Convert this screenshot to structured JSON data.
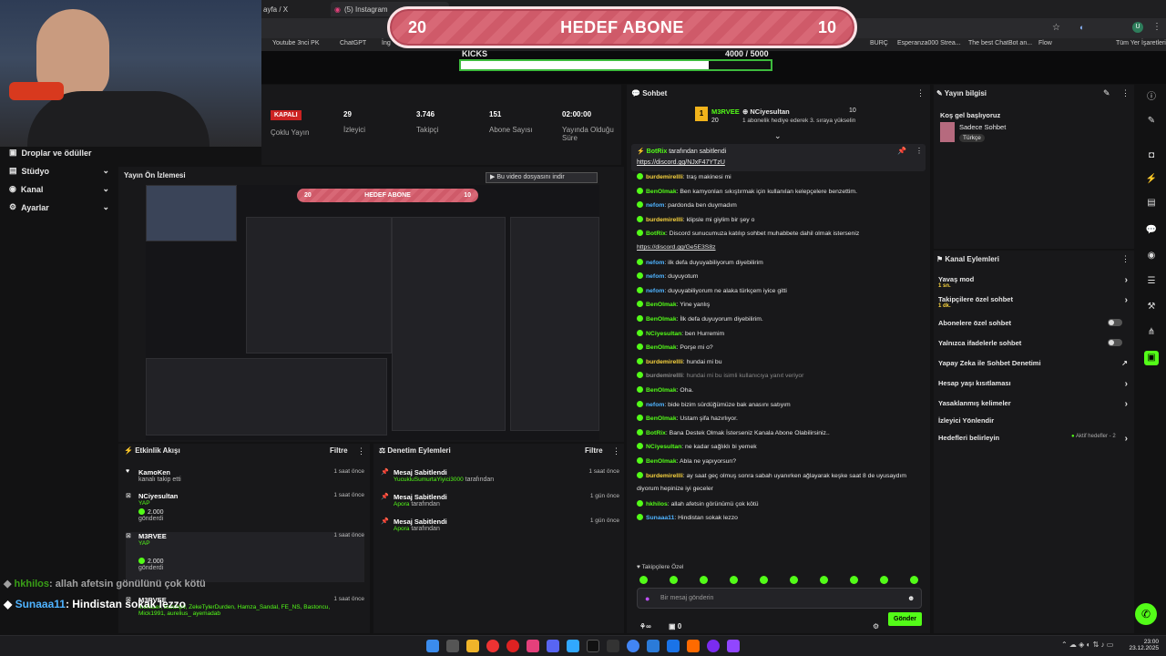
{
  "browser": {
    "tabs": [
      "ayfa / X",
      "(5) Instagram"
    ],
    "bookmarks": [
      "Youtube 3nci PK",
      "ChatGPT",
      "İng",
      "BURÇ",
      "Esperanza000 Strea...",
      "The best ChatBot an...",
      "Flow",
      "Tüm Yer İşaretleri"
    ]
  },
  "goal": {
    "left": "20",
    "title": "HEDEF ABONE",
    "right": "10"
  },
  "kicks": {
    "label": "KICKS",
    "current": "4000",
    "sep": "/",
    "target": "5000",
    "progress": 0.8
  },
  "leftnav": [
    {
      "label": "Droplar ve ödüller",
      "icon": "gift-icon"
    },
    {
      "label": "Stüdyo",
      "icon": "studio-icon"
    },
    {
      "label": "Kanal",
      "icon": "channel-icon"
    },
    {
      "label": "Ayarlar",
      "icon": "gear-icon"
    }
  ],
  "stats": {
    "status": "KAPALI",
    "mode": "Çoklu Yayın",
    "viewers_v": "29",
    "viewers_l": "İzleyici",
    "followers_v": "3.746",
    "followers_l": "Takipçi",
    "subs_v": "151",
    "subs_l": "Abone Sayısı",
    "uptime_v": "02:00:00",
    "uptime_l": "Yayında Olduğu Süre"
  },
  "preview": {
    "title": "Yayın Ön İzlemesi",
    "download": "Bu video dosyasını indir",
    "mini_left": "20",
    "mini_title": "HEDEF ABONE",
    "mini_right": "10"
  },
  "activity": {
    "title": "Etkinlik Akışı",
    "filter": "Filtre",
    "items": [
      {
        "name": "KamoKen",
        "sub": "kanalı takip etti",
        "time": "1 saat önce"
      },
      {
        "name": "NCiyesultan",
        "sub": "YAP",
        "amount": "2.000",
        "action": "gönderdi",
        "time": "1 saat önce"
      },
      {
        "name": "M3RVEE",
        "sub": "YAP",
        "amount": "2.000",
        "action": "gönderdi",
        "time": "1 saat önce"
      },
      {
        "name": "M3RVEE",
        "sub": "melisaer, Baranpv, ZekeTylerDurden, Hamza_Sandal, FE_NS, Bastoncu, Mick1991, aurelius_ ayemadab",
        "time": "1 saat önce"
      }
    ]
  },
  "moderation": {
    "title": "Denetim Eylemleri",
    "filter": "Filtre",
    "items": [
      {
        "name": "Mesaj Sabitlendi",
        "user": "YucukluSumurtaYiyici3000",
        "suffix": "tarafından",
        "time": "1 saat önce"
      },
      {
        "name": "Mesaj Sabitlendi",
        "user": "Apora",
        "suffix": "tarafından",
        "time": "1 gün önce"
      },
      {
        "name": "Mesaj Sabitlendi",
        "user": "Apora",
        "suffix": "tarafından",
        "time": "1 gün önce"
      }
    ]
  },
  "bigchat": [
    {
      "user": "hkhilos",
      "text": ": allah afetsin gönülünü çok kötü"
    },
    {
      "user": "Sunaaa11",
      "text": ": Hindistan sokak lezzo"
    }
  ],
  "chat": {
    "title": "Sohbet",
    "gift_user": "M3RVEE",
    "gift_count": "20",
    "gift_target": "NCiyesultan",
    "gift_num": "10",
    "gift_text": "1 abonelik hediye ederek 3. sıraya yükselin",
    "pinned_by": "BotRix",
    "pinned_suffix": "tarafından sabitlendi",
    "pinned_link": "https://discord.gg/NJxF47YTzU",
    "messages": [
      {
        "user": "burdemirellli",
        "text": ": traş makinesi mi",
        "color": "#f7d23e"
      },
      {
        "user": "BenOlmak",
        "text": ": Ben kamyonları sıkıştırmak için kullanılan kelepçelere benzettim.",
        "color": "#53fc18"
      },
      {
        "user": "nefom",
        "text": ": pardonda ben duymadım",
        "color": "#4fb3ff"
      },
      {
        "user": "burdemirellli",
        "text": ": klipsle mi giylim bir şey o",
        "color": "#f7d23e"
      },
      {
        "user": "BotRix",
        "text": ": Discord sunucumuza katılıp sohbet muhabbete dahil olmak isterseniz",
        "color": "#53fc18"
      },
      {
        "user": "",
        "text": "https://discord.gg/Ge5E3S8z",
        "color": "#fff"
      },
      {
        "user": "nefom",
        "text": ": ilk defa duyuyabiliyorum diyebilirim",
        "color": "#4fb3ff"
      },
      {
        "user": "nefom",
        "text": ": duyuyotum",
        "color": "#4fb3ff"
      },
      {
        "user": "nefom",
        "text": ": duyuyabiliyorum ne alaka türkçem iyice gitti",
        "color": "#4fb3ff"
      },
      {
        "user": "BenOlmak",
        "text": ": Yine yanlış",
        "color": "#53fc18"
      },
      {
        "user": "BenOlmak",
        "text": ": İlk defa duyuyorum diyebilirim.",
        "color": "#53fc18"
      },
      {
        "user": "NCiyesultan",
        "text": ": ben Hurremim",
        "color": "#53fc18"
      },
      {
        "user": "BenOlmak",
        "text": ": Porşe mi o?",
        "color": "#53fc18"
      },
      {
        "user": "burdemirellli",
        "text": ": hundai mi bu",
        "color": "#f7d23e"
      },
      {
        "user": "burdemirellli",
        "text": ": hundai mi bu isimli kullanıcıya yanıt veriyor",
        "color": "#888"
      },
      {
        "user": "BenOlmak",
        "text": ": Oha.",
        "color": "#53fc18"
      },
      {
        "user": "nefom",
        "text": ": bide bizim sürdüğümüze bak anasını satıyım",
        "color": "#4fb3ff"
      },
      {
        "user": "BenOlmak",
        "text": ": Ustam şifa hazırlıyor.",
        "color": "#53fc18"
      },
      {
        "user": "BotRix",
        "text": ": Bana Destek Olmak İsterseniz Kanala Abone Olabilirsiniz..",
        "color": "#53fc18"
      },
      {
        "user": "NCiyesultan",
        "text": ": ne kadar sağlıklı bi yemek",
        "color": "#53fc18"
      },
      {
        "user": "BenOlmak",
        "text": ": Abla ne yapıyorsun?",
        "color": "#53fc18"
      },
      {
        "user": "burdemirellli",
        "text": ": ay saat geç olmuş sonra sabah uyanırken ağlayarak keşke saat 8 de uyusaydım",
        "color": "#f7d23e"
      },
      {
        "user": "",
        "text": "diyorum hepinize iyi geceler",
        "color": "#fff"
      },
      {
        "user": "hkhilos",
        "text": ": allah afetsin görünümü çok kötü",
        "color": "#53fc18"
      },
      {
        "user": "Sunaaa11",
        "text": ": Hindistan sokak lezzo",
        "color": "#4fb3ff"
      }
    ],
    "followers_only": "Takipçilere Özel",
    "placeholder": "Bir mesaj gönderin",
    "points": "0",
    "send": "Gönder"
  },
  "info": {
    "title": "Yayın bilgisi",
    "stream_title": "Koş gel başlıyoruz",
    "category": "Sadece Sohbet",
    "lang": "Türkçe"
  },
  "actions": {
    "title": "Kanal Eylemleri",
    "items": [
      {
        "label": "Yavaş mod",
        "sub": "1 sn.",
        "ctrl": "arrow"
      },
      {
        "label": "Takipçilere özel sohbet",
        "sub": "1 dk.",
        "ctrl": "arrow"
      },
      {
        "label": "Abonelere özel sohbet",
        "sub": "",
        "ctrl": "toggle"
      },
      {
        "label": "Yalnızca ifadelerle sohbet",
        "sub": "",
        "ctrl": "toggle"
      },
      {
        "label": "Yapay Zeka ile Sohbet Denetimi",
        "sub": "",
        "ctrl": "ext"
      },
      {
        "label": "Hesap yaşı kısıtlaması",
        "sub": "",
        "ctrl": "arrow"
      },
      {
        "label": "Yasaklanmış kelimeler",
        "sub": "",
        "ctrl": "arrow"
      },
      {
        "label": "İzleyici Yönlendir",
        "sub": "",
        "ctrl": "none"
      },
      {
        "label": "Hedefleri belirleyin",
        "sub": "",
        "ctrl": "arrow",
        "extra": "Aktif hedefler - 2"
      }
    ]
  },
  "clock": {
    "time": "23:00",
    "date": "23.12.2025"
  }
}
